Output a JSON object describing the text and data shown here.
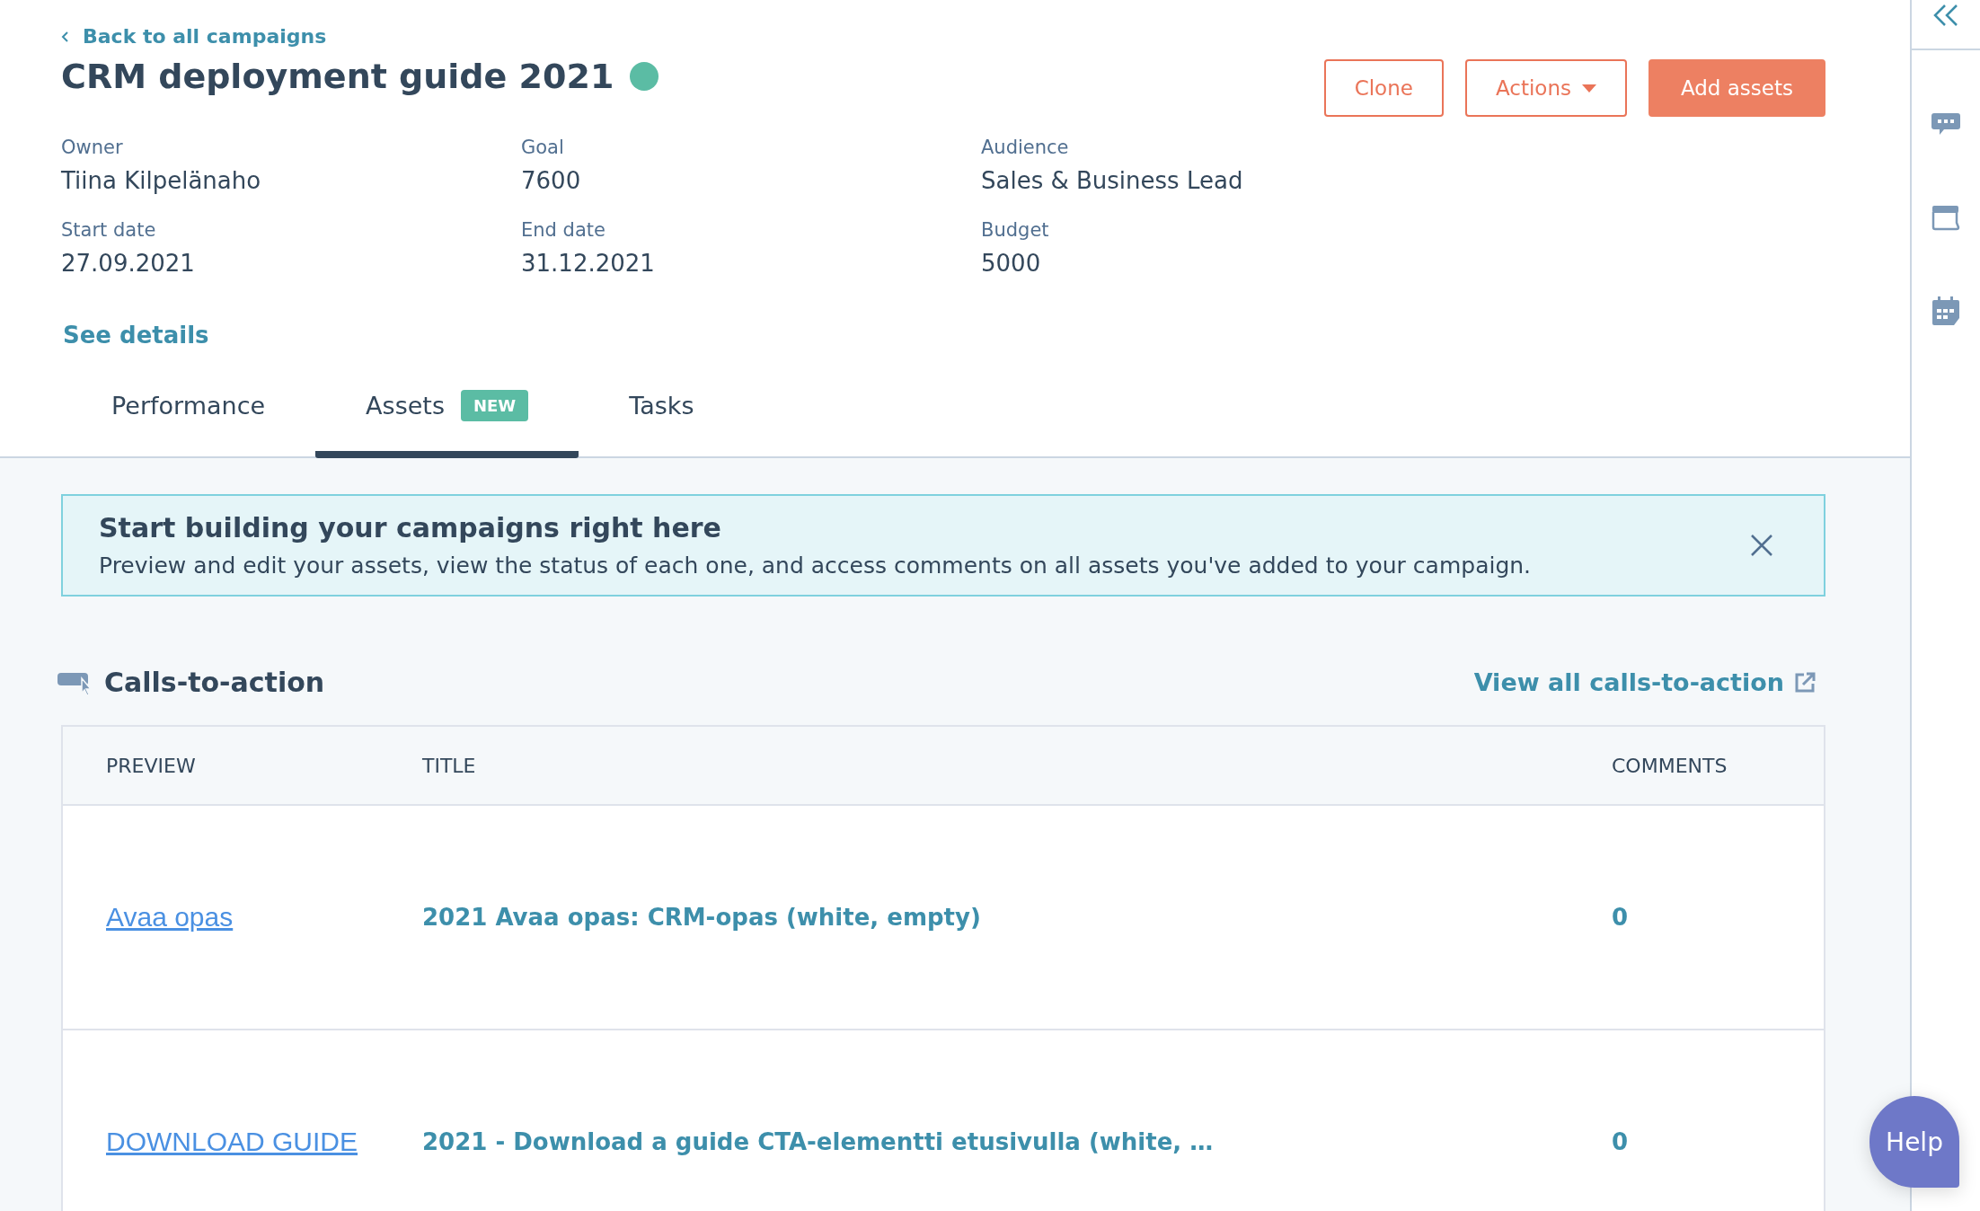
{
  "back_link": "Back to all campaigns",
  "campaign_title": "CRM deployment guide 2021",
  "header_buttons": [
    {
      "label": "Clone",
      "kind": "secondary"
    },
    {
      "label": "Actions",
      "kind": "dropdown"
    },
    {
      "label": "Add assets",
      "kind": "primary"
    }
  ],
  "details": [
    {
      "label": "Owner",
      "value": "Tiina Kilpelänaho"
    },
    {
      "label": "Goal",
      "value": "7600"
    },
    {
      "label": "Audience",
      "value": "Sales & Business Lead"
    },
    {
      "label": "Start date",
      "value": "27.09.2021"
    },
    {
      "label": "End date",
      "value": "31.12.2021"
    },
    {
      "label": "Budget",
      "value": "5000"
    }
  ],
  "see_details": "See details",
  "tabs": [
    {
      "label": "Performance",
      "selected": false
    },
    {
      "label": "Assets",
      "selected": true,
      "badge": "NEW"
    },
    {
      "label": "Tasks",
      "selected": false
    }
  ],
  "banner": {
    "title": "Start building your campaigns right here",
    "text": "Preview and edit your assets, view the status of each one, and access comments on all assets you've added to your campaign."
  },
  "section": {
    "title": "Calls-to-action",
    "link": "View all calls-to-action"
  },
  "table": {
    "columns": [
      "PREVIEW",
      "TITLE",
      "COMMENTS"
    ],
    "rows": [
      {
        "preview": "Avaa opas",
        "title": "2021 Avaa opas: CRM-opas (white, empty)",
        "comments": "0"
      },
      {
        "preview": "DOWNLOAD GUIDE",
        "title": "2021 - Download a guide CTA-elementti etusivulla (white, …",
        "comments": "0"
      }
    ]
  },
  "help_button": "Help"
}
